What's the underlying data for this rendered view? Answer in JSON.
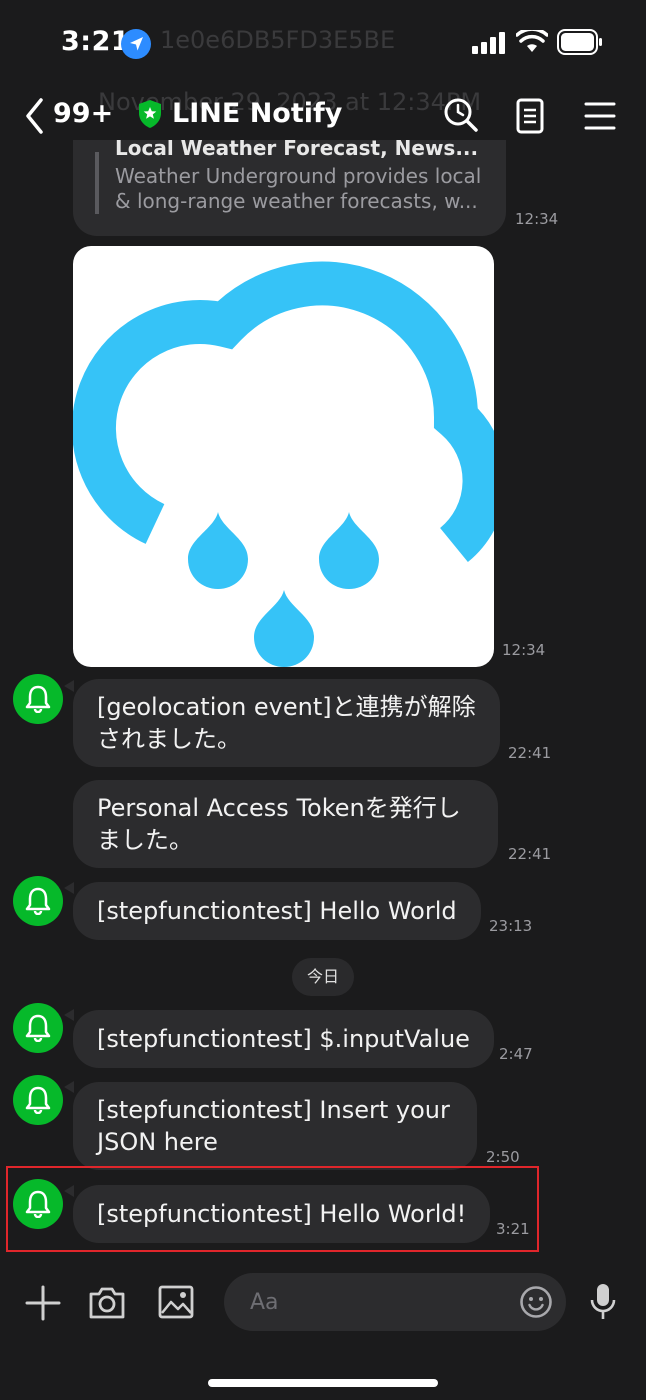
{
  "status": {
    "time": "3:21"
  },
  "ghost": {
    "line1": "1e0e6DB5FD3E5BE",
    "line2": "November 29, 2023 at 12:34PM"
  },
  "header": {
    "unread": "99+",
    "title": "LINE Notify"
  },
  "link_preview": {
    "title": "Local Weather Forecast, News...",
    "description": "Weather Underground provides local & long-range weather forecasts, w...",
    "time": "12:34"
  },
  "image_message": {
    "time": "12:34"
  },
  "messages": [
    {
      "text": "[geolocation event]と連携が解除されました。",
      "time": "22:41"
    },
    {
      "text": "Personal Access Tokenを発行しました。",
      "time": "22:41"
    },
    {
      "text": "[stepfunctiontest] Hello World",
      "time": "23:13"
    },
    {
      "text": "[stepfunctiontest] $.inputValue",
      "time": "2:47"
    },
    {
      "text": "[stepfunctiontest] Insert your JSON here",
      "time": "2:50"
    },
    {
      "text": "[stepfunctiontest] Hello World!",
      "time": "3:21"
    }
  ],
  "date_divider": "今日",
  "composer": {
    "placeholder": "Aa"
  },
  "colors": {
    "accent_green": "#06b92a",
    "highlight": "#e0262b",
    "bubble": "#2c2c2e",
    "rain_blue": "#36c3f7"
  },
  "icons": [
    "location-arrow-icon",
    "signal-icon",
    "wifi-icon",
    "battery-icon",
    "back-chevron-icon",
    "verified-shield-icon",
    "search-icon",
    "notes-icon",
    "menu-icon",
    "bell-icon",
    "plus-icon",
    "camera-icon",
    "image-icon",
    "emoji-icon",
    "microphone-icon"
  ]
}
